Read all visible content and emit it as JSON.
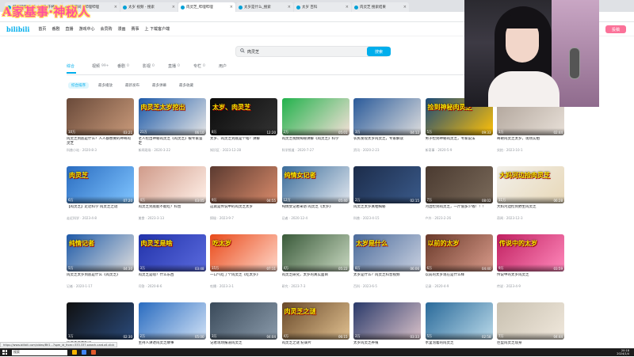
{
  "overlay": {
    "banner_text": "A家基事·神秘人"
  },
  "browser": {
    "tabs": [
      {
        "label": "哔哩哔哩 (゜-゜)つロ 干杯~",
        "active": false
      },
      {
        "label": "直播间 - 哔哩哔哩",
        "active": false
      },
      {
        "label": "太岁 视频 - 搜索",
        "active": false
      },
      {
        "label": "肉灵芝_哔哩哔哩",
        "active": true
      },
      {
        "label": "太岁是什么_搜索",
        "active": false
      },
      {
        "label": "太岁 百科",
        "active": false
      },
      {
        "label": "肉灵芝 搜索结果",
        "active": false
      }
    ],
    "status_url": "https://www.bilibili.com/video/BV1...?spm_id_from=333.337.search-card.all.click"
  },
  "header": {
    "logo": "bilibili",
    "nav": [
      "首页",
      "番剧",
      "直播",
      "游戏中心",
      "会员购",
      "漫画",
      "赛事",
      "上 下载客户端"
    ],
    "upload": "投稿"
  },
  "search": {
    "query": "肉灵芝",
    "button": "搜索"
  },
  "type_tabs": [
    {
      "label": "综合",
      "count": "",
      "active": true
    },
    {
      "label": "视频",
      "count": "99+",
      "active": false
    },
    {
      "label": "番剧",
      "count": "0",
      "active": false
    },
    {
      "label": "影视",
      "count": "0",
      "active": false
    },
    {
      "label": "直播",
      "count": "0",
      "active": false
    },
    {
      "label": "专栏",
      "count": "0",
      "active": false
    },
    {
      "label": "用户",
      "count": "",
      "active": false
    }
  ],
  "sort_tabs": [
    {
      "label": "综合排序",
      "active": true
    },
    {
      "label": "最多播放",
      "active": false
    },
    {
      "label": "最新发布",
      "active": false
    },
    {
      "label": "最多弹幕",
      "active": false
    },
    {
      "label": "最多收藏",
      "active": false
    }
  ],
  "videos": [
    {
      "caption": "",
      "dur": "03:21",
      "stat": "10万",
      "title": "肉灵芝到底是什么？人人都想要的神奇肉灵芝",
      "meta": "科普小站 · 2020-8-3",
      "c1": "#6a4a3a",
      "c2": "#c99a7a"
    },
    {
      "caption": "肉灵芝太岁挖出",
      "dur": "06:10",
      "stat": "21万",
      "title": "老人挖出神秘肉灵芝《肉灵芝》被专家鉴定",
      "meta": "新闻现场 · 2020-3-22",
      "c1": "#1e5aa8",
      "c2": "#e6e6e6"
    },
    {
      "caption": "太岁、肉灵芝",
      "dur": "12:20",
      "stat": "8万",
      "title": "太岁、肉灵芝到底是个啥？讲解",
      "meta": "知识区 · 2023-12-28",
      "c1": "#0b0b0b",
      "c2": "#333"
    },
    {
      "caption": "",
      "dur": "05:01",
      "stat": "2万",
      "title": "肉灵芝视频揭秘讲解《肉灵芝》科学",
      "meta": "科学频道 · 2020-7-27",
      "c1": "#22b24c",
      "c2": "#f5e0d8"
    },
    {
      "caption": "",
      "dur": "04:12",
      "stat": "3万",
      "title": "农民发现太岁肉灵芝，专家解读",
      "meta": "资讯 · 2020-2-23",
      "c1": "#2a5a9a",
      "c2": "#ddd"
    },
    {
      "caption": "捡到神秘肉灵芝",
      "dur": "09:33",
      "stat": "5万",
      "title": "男子捡到神秘肉灵芝，专家说法",
      "meta": "新奇事 · 2020-5-9",
      "c1": "#1b4a78",
      "c2": "#ffc107"
    },
    {
      "caption": "",
      "dur": "02:44",
      "stat": "1万",
      "title": "奇葩肉灵芝太岁，现场实拍",
      "meta": "实拍 · 2023-10-1",
      "c1": "#b0a49a",
      "c2": "#e8e0d8"
    },
    {
      "caption": "肉灵芝",
      "dur": "07:20",
      "stat": "6万",
      "title": "【肉灵芝】走近科学 肉灵芝之谜",
      "meta": "走近科学 · 2023-4-8",
      "c1": "#2a6cc0",
      "c2": "#7fc4ff"
    },
    {
      "caption": "",
      "dur": "03:05",
      "stat": "4万",
      "title": "肉灵芝到底能不能吃？科普",
      "meta": "美食 · 2023-3-13",
      "c1": "#d09b8a",
      "c2": "#fff0e8"
    },
    {
      "caption": "",
      "dur": "04:55",
      "stat": "9万",
      "title": "这就是传说中的肉灵芝太岁",
      "meta": "探秘 · 2023-9-7",
      "c1": "#5b3a30",
      "c2": "#d88a6a"
    },
    {
      "caption": "纯情女记者",
      "dur": "05:40",
      "stat": "12万",
      "title": "纯情女记者采访 肉灵芝《太岁》",
      "meta": "记者 · 2020-12-4",
      "c1": "#3a6c9a",
      "c2": "#e0e6ee"
    },
    {
      "caption": "",
      "dur": "02:15",
      "stat": "2万",
      "title": "肉灵芝太岁真相揭秘",
      "meta": "科普 · 2023-4-15",
      "c1": "#1c2c4a",
      "c2": "#3a5a8a"
    },
    {
      "caption": "",
      "dur": "08:02",
      "stat": "7万",
      "title": "河边捡到肉灵芝，一斤值多少钱！！！",
      "meta": "户外 · 2023-2-26",
      "c1": "#4a3a30",
      "c2": "#7a6a5a"
    },
    {
      "caption": "大妈河边捡肉灵芝",
      "dur": "06:28",
      "stat": "11万",
      "title": "大妈河边捡到野生肉灵芝",
      "meta": "奇闻 · 2023-12-3",
      "c1": "#f2f0ea",
      "c2": "#e8d8b8"
    },
    {
      "caption": "纯情记者",
      "dur": "04:30",
      "stat": "5万",
      "title": "肉灵芝太岁到底是什么《肉灵芝》",
      "meta": "记者 · 2020-1-17",
      "c1": "#1e5aa8",
      "c2": "#ddd"
    },
    {
      "caption": "肉灵芝是啥",
      "dur": "03:48",
      "stat": "3万",
      "title": "肉灵芝是啥？什么东西",
      "meta": "问答 · 2020-8-6",
      "c1": "#2233aa",
      "c2": "#5a6add"
    },
    {
      "caption": "吃太岁",
      "dur": "07:11",
      "stat": "15万",
      "title": "一口气吃了个肉灵芝《吃太岁》",
      "meta": "吃播 · 2023-3-1",
      "c1": "#e94a1a",
      "c2": "#ffd6c8"
    },
    {
      "caption": "",
      "dur": "05:22",
      "stat": "4万",
      "title": "肉灵芝研究，太岁的真实面目",
      "meta": "研究 · 2023-7-3",
      "c1": "#3a5a3a",
      "c2": "#c8d8c0"
    },
    {
      "caption": "太岁是什么",
      "dur": "06:06",
      "stat": "8万",
      "title": "太岁是什么？肉灵芝科普视频",
      "meta": "百科 · 2023-6-5",
      "c1": "#4a6a9a",
      "c2": "#c8d0e0"
    },
    {
      "caption": "以前的太岁",
      "dur": "04:40",
      "stat": "6万",
      "title": "以前的太岁现在是什么样",
      "meta": "记录 · 2020-4-9",
      "c1": "#6a3a2a",
      "c2": "#d89a8a"
    },
    {
      "caption": "传说中的太岁",
      "dur": "03:59",
      "stat": "9万",
      "title": "传说中的太岁肉灵芝",
      "meta": "传说 · 2023-4-9",
      "c1": "#c02060",
      "c2": "#ff88bb"
    },
    {
      "caption": "",
      "dur": "02:30",
      "stat": "1万",
      "title": "肉灵芝新闻报道",
      "meta": "新闻 · 2023-1-5",
      "c1": "#101010",
      "c2": "#2a4a7a"
    },
    {
      "caption": "",
      "dur": "05:00",
      "stat": "2万",
      "title": "主持人讲述肉灵芝故事",
      "meta": "电视 · 2023-5-1",
      "c1": "#2a6cc0",
      "c2": "#cfe0f5"
    },
    {
      "caption": "",
      "dur": "04:04",
      "stat": "3万",
      "title": "记者现场报道肉灵芝",
      "meta": "报道 · 2020-9-1",
      "c1": "#3a4a5a",
      "c2": "#8a9aaa"
    },
    {
      "caption": "肉灵芝之谜",
      "dur": "06:15",
      "stat": "4万",
      "title": "肉灵芝之谜 纪录片",
      "meta": "纪录 · 2020-2-2",
      "c1": "#6a4a2a",
      "c2": "#e0c090"
    },
    {
      "caption": "",
      "dur": "03:33",
      "stat": "2万",
      "title": "太岁肉灵芝养殖",
      "meta": "养殖 · 2023-8-8",
      "c1": "#2a3a6a",
      "c2": "#d8c0c8"
    },
    {
      "caption": "",
      "dur": "02:58",
      "stat": "5万",
      "title": "水里泡着的肉灵芝",
      "meta": "实验 · 2023-6-6",
      "c1": "#2a6a9a",
      "c2": "#b8d8e8"
    },
    {
      "caption": "",
      "dur": "04:44",
      "stat": "7万",
      "title": "巨型肉灵芝现身",
      "meta": "奇观 · 2023-10-10",
      "c1": "#c8c0b0",
      "c2": "#f0e8dc"
    }
  ],
  "taskbar": {
    "search_placeholder": "搜索",
    "time": "20:18",
    "date": "2024/1/4"
  }
}
